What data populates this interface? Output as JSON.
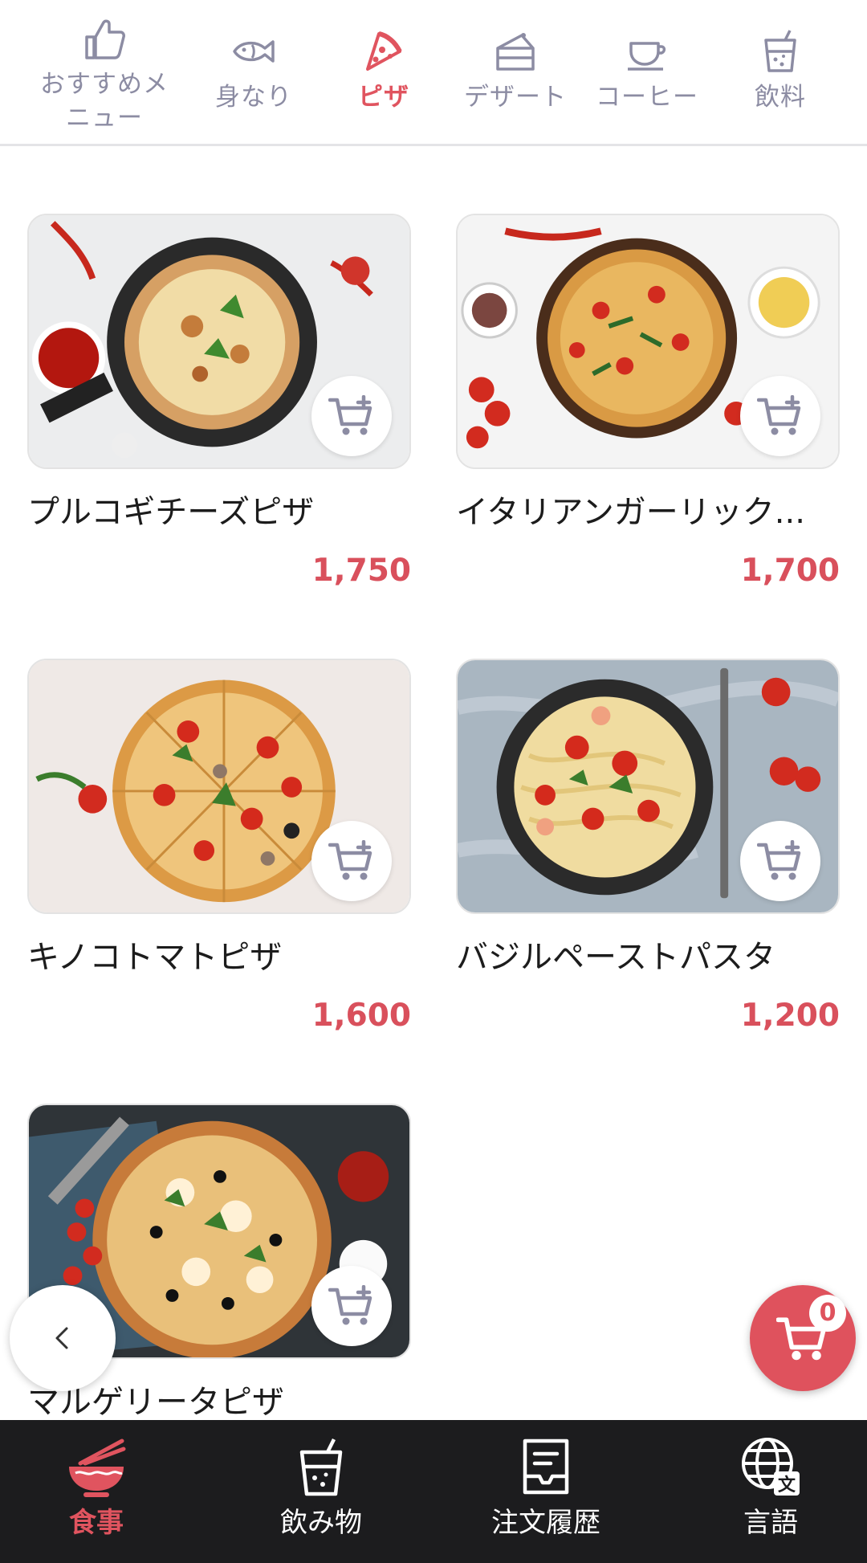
{
  "categories": [
    {
      "label": "おすすめメ\nニュー",
      "icon": "thumbs-up-icon",
      "active": false
    },
    {
      "label": "身なり",
      "icon": "fish-icon",
      "active": false
    },
    {
      "label": "ピザ",
      "icon": "pizza-slice-icon",
      "active": true
    },
    {
      "label": "デザート",
      "icon": "cake-icon",
      "active": false
    },
    {
      "label": "コーヒー",
      "icon": "coffee-cup-icon",
      "active": false
    },
    {
      "label": "飲料",
      "icon": "drink-cup-icon",
      "active": false
    }
  ],
  "products": [
    {
      "name": "プルコギチーズピザ",
      "price": "1,750"
    },
    {
      "name": "イタリアンガーリック...",
      "price": "1,700"
    },
    {
      "name": "キノコトマトピザ",
      "price": "1,600"
    },
    {
      "name": "バジルペーストパスタ",
      "price": "1,200"
    },
    {
      "name": "マルゲリータピザ",
      "price": ""
    }
  ],
  "cart": {
    "count": "0"
  },
  "bottom_nav": [
    {
      "label": "食事",
      "icon": "noodle-bowl-icon",
      "active": true
    },
    {
      "label": "飲み物",
      "icon": "drink-cup-icon",
      "active": false
    },
    {
      "label": "注文履歴",
      "icon": "order-history-icon",
      "active": false
    },
    {
      "label": "言語",
      "icon": "globe-language-icon",
      "active": false
    }
  ],
  "colors": {
    "accent": "#e0545f",
    "icon_gray": "#8c8ca3",
    "nav_bg": "#1c1c1e"
  }
}
